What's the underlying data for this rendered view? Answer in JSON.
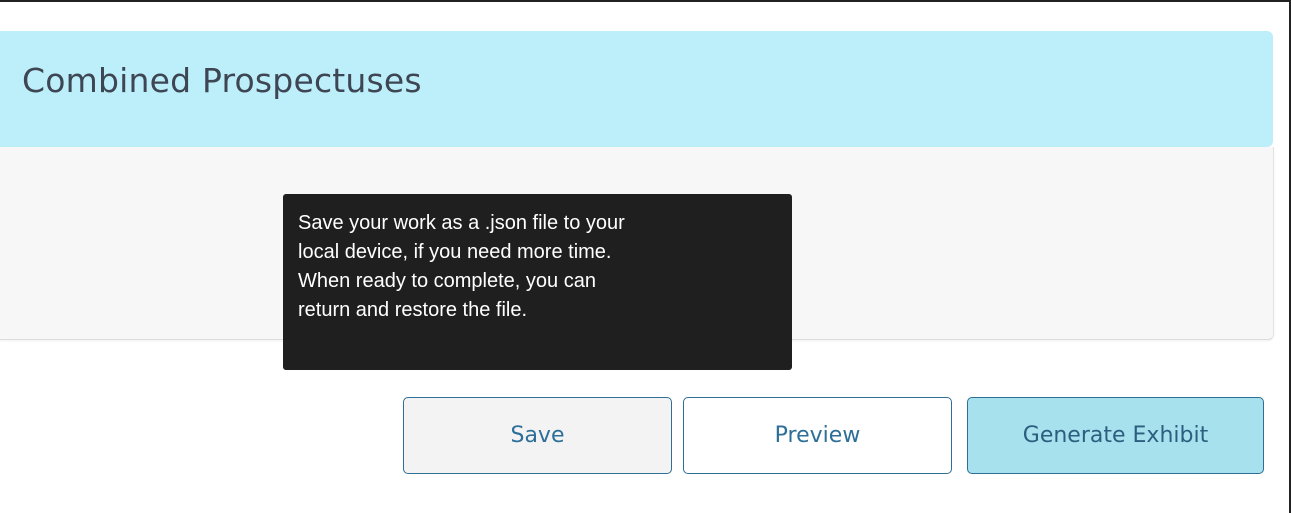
{
  "header": {
    "title": "Combined Prospectuses"
  },
  "tooltip": {
    "lines": [
      "Save your work as a .json file to your",
      "local device, if you need more time.",
      "When ready to complete, you can",
      "return and restore the file."
    ]
  },
  "actions": {
    "save_label": "Save",
    "preview_label": "Preview",
    "generate_label": "Generate Exhibit"
  },
  "colors": {
    "header_background": "#bdeffb",
    "body_panel_background": "#f7f7f8",
    "tooltip_background": "#1f1f1f",
    "button_border": "#2f6f96",
    "button_text": "#2d6f98",
    "generate_button_background": "#a7e1ee"
  }
}
